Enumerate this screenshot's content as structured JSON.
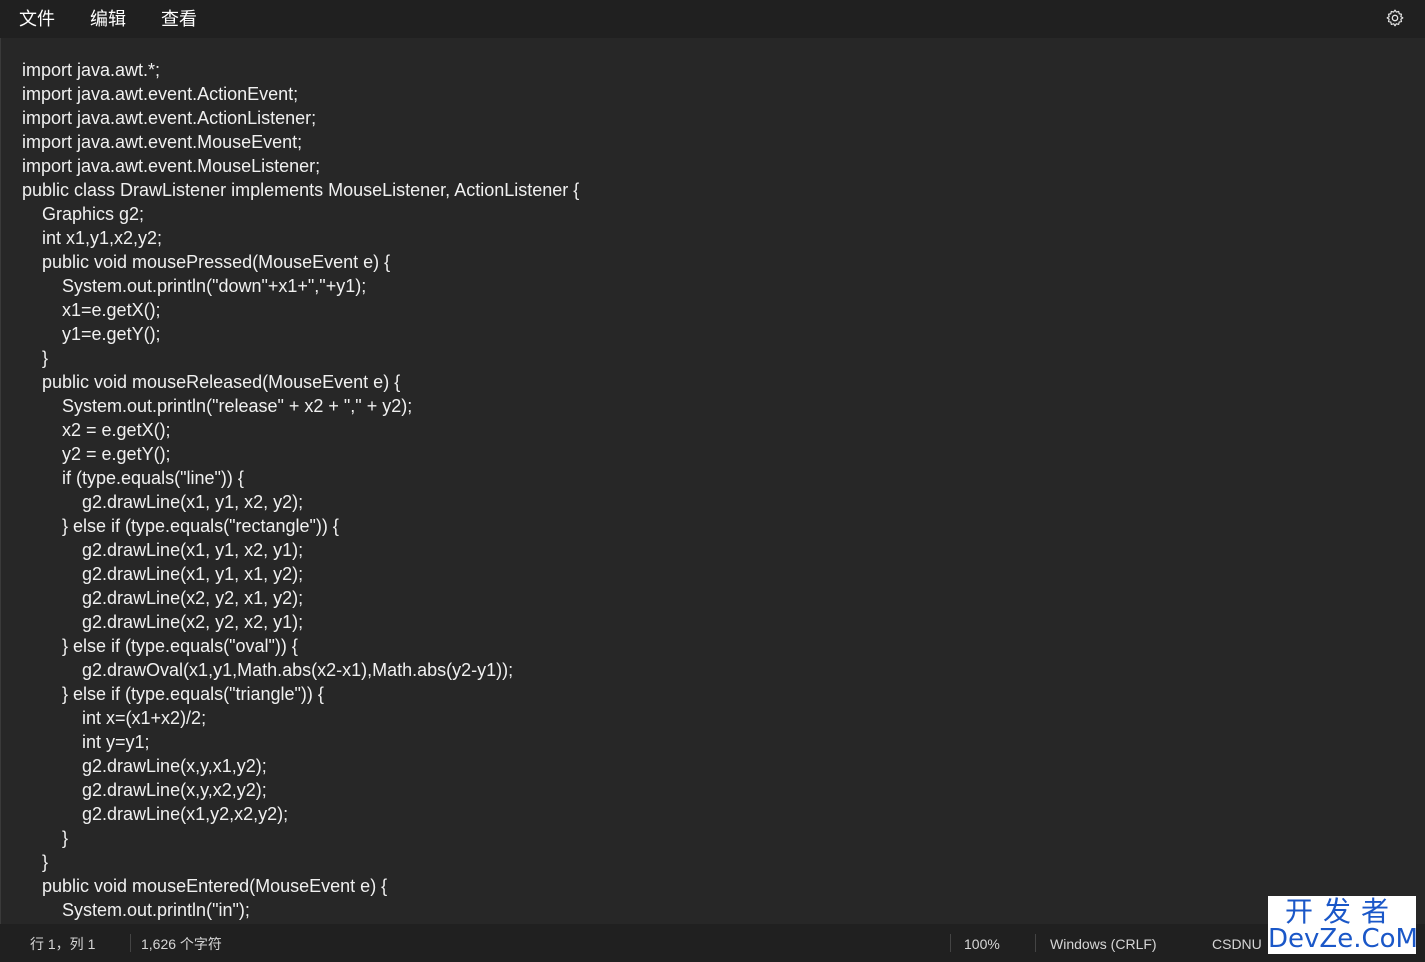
{
  "menubar": {
    "items": [
      "文件",
      "编辑",
      "查看"
    ],
    "settings_icon": "gear-icon"
  },
  "editor": {
    "lines": [
      "import java.awt.*;",
      "import java.awt.event.ActionEvent;",
      "import java.awt.event.ActionListener;",
      "import java.awt.event.MouseEvent;",
      "import java.awt.event.MouseListener;",
      "public class DrawListener implements MouseListener, ActionListener {",
      "    Graphics g2;",
      "    int x1,y1,x2,y2;",
      "    public void mousePressed(MouseEvent e) {",
      "        System.out.println(\"down\"+x1+\",\"+y1);",
      "        x1=e.getX();",
      "        y1=e.getY();",
      "    }",
      "    public void mouseReleased(MouseEvent e) {",
      "        System.out.println(\"release\" + x2 + \",\" + y2);",
      "        x2 = e.getX();",
      "        y2 = e.getY();",
      "        if (type.equals(\"line\")) {",
      "            g2.drawLine(x1, y1, x2, y2);",
      "        } else if (type.equals(\"rectangle\")) {",
      "            g2.drawLine(x1, y1, x2, y1);",
      "            g2.drawLine(x1, y1, x1, y2);",
      "            g2.drawLine(x2, y2, x1, y2);",
      "            g2.drawLine(x2, y2, x2, y1);",
      "        } else if (type.equals(\"oval\")) {",
      "            g2.drawOval(x1,y1,Math.abs(x2-x1),Math.abs(y2-y1));",
      "        } else if (type.equals(\"triangle\")) {",
      "            int x=(x1+x2)/2;",
      "            int y=y1;",
      "            g2.drawLine(x,y,x1,y2);",
      "            g2.drawLine(x,y,x2,y2);",
      "            g2.drawLine(x1,y2,x2,y2);",
      "        }",
      "    }",
      "    public void mouseEntered(MouseEvent e) {",
      "        System.out.println(\"in\");"
    ]
  },
  "statusbar": {
    "position": "行 1，列 1",
    "char_count": "1,626 个字符",
    "zoom": "100%",
    "line_ending": "Windows (CRLF)",
    "partial_text": "CSDNU"
  },
  "watermark": {
    "top": "开发者",
    "bottom": "DevZe.CoM"
  }
}
